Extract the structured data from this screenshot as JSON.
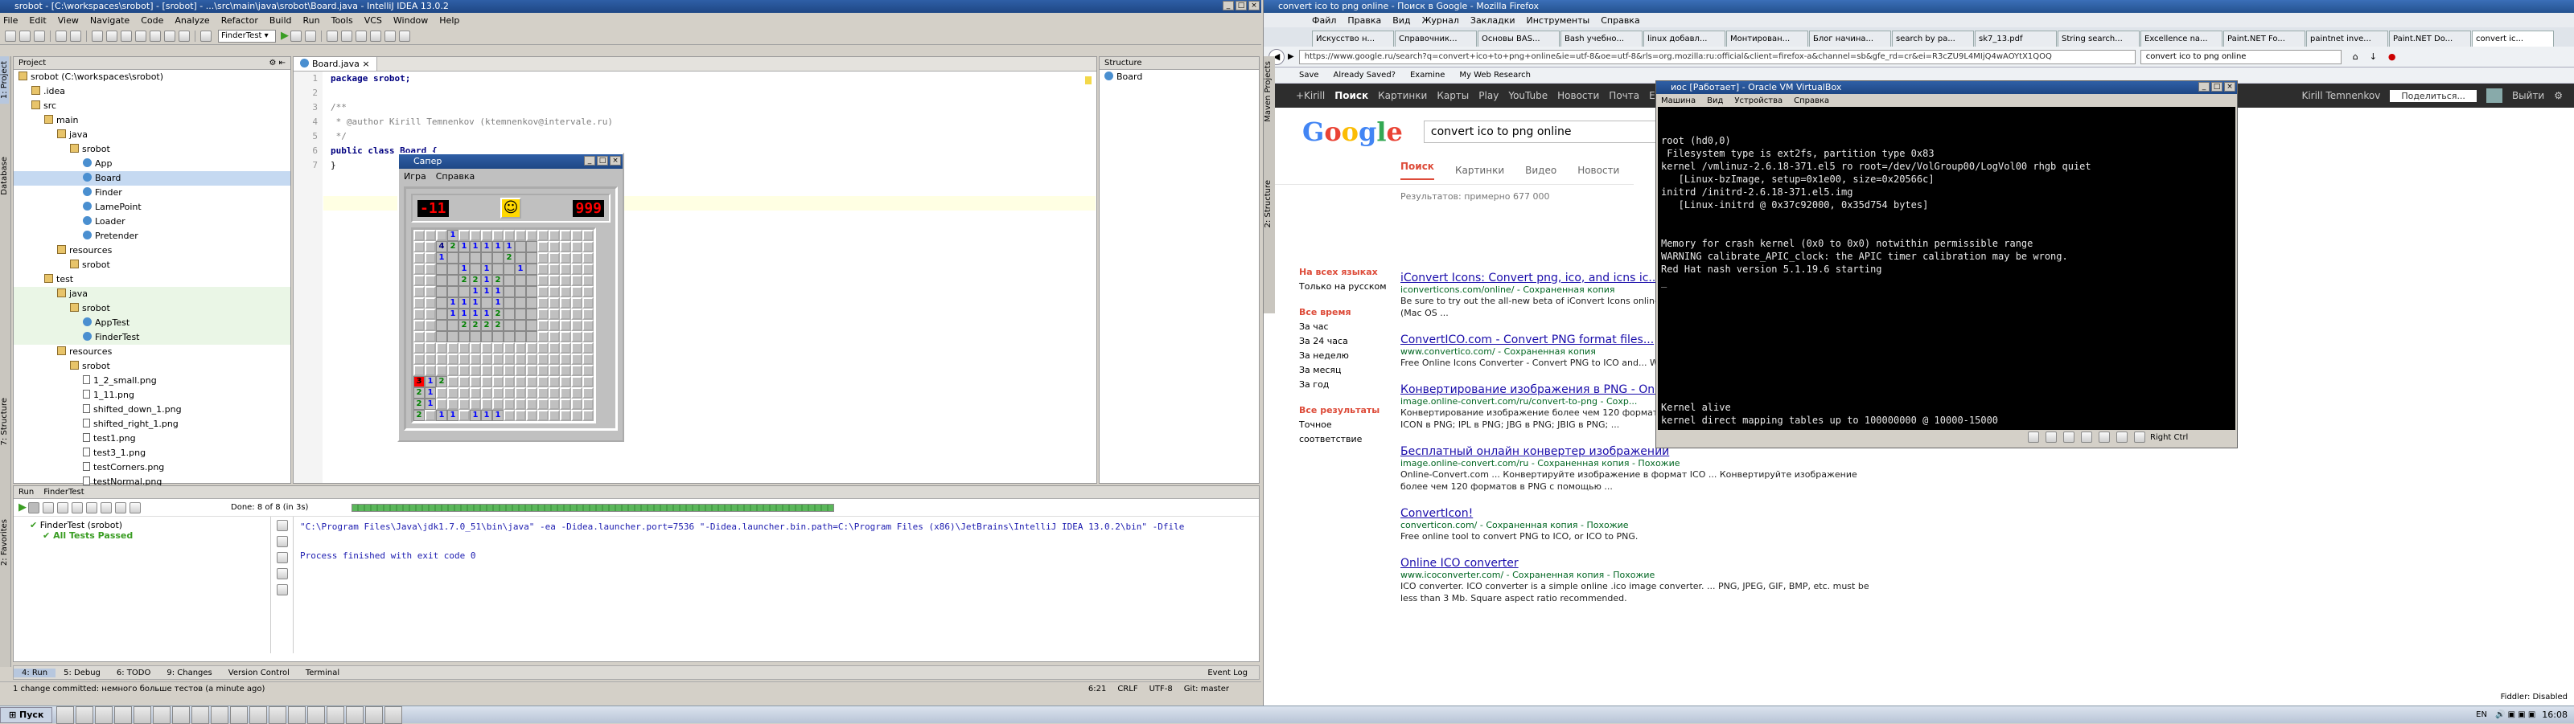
{
  "colors": {
    "ide_bg": "#d4d0c8",
    "selected": "#c5d9f1",
    "test_green": "#5bb75b",
    "google_red": "#dd4b39",
    "vm_console_bg": "#000000",
    "vm_text": "#e8e8e8",
    "link": "#1a0dab",
    "url_green": "#006621"
  },
  "ide": {
    "title": "srobot - [C:\\workspaces\\srobot] - [srobot] - ...\\src\\main\\java\\srobot\\Board.java - IntelliJ IDEA 13.0.2",
    "menu": [
      "File",
      "Edit",
      "View",
      "Navigate",
      "Code",
      "Analyze",
      "Refactor",
      "Build",
      "Run",
      "Tools",
      "VCS",
      "Window",
      "Help"
    ],
    "run_config": "FinderTest",
    "project_header": "Project",
    "left_tabs": [
      "1: Project",
      "Database",
      "7: Structure",
      "2: Favorites"
    ],
    "tree": [
      {
        "label": "srobot (C:\\workspaces\\srobot)",
        "indent": 0,
        "kind": "folder"
      },
      {
        "label": ".idea",
        "indent": 1,
        "kind": "folder"
      },
      {
        "label": "src",
        "indent": 1,
        "kind": "folder"
      },
      {
        "label": "main",
        "indent": 2,
        "kind": "folder"
      },
      {
        "label": "java",
        "indent": 3,
        "kind": "folder"
      },
      {
        "label": "srobot",
        "indent": 4,
        "kind": "folder"
      },
      {
        "label": "App",
        "indent": 5,
        "kind": "class"
      },
      {
        "label": "Board",
        "indent": 5,
        "kind": "class",
        "selected": true
      },
      {
        "label": "Finder",
        "indent": 5,
        "kind": "class"
      },
      {
        "label": "LamePoint",
        "indent": 5,
        "kind": "class"
      },
      {
        "label": "Loader",
        "indent": 5,
        "kind": "class"
      },
      {
        "label": "Pretender",
        "indent": 5,
        "kind": "class"
      },
      {
        "label": "resources",
        "indent": 3,
        "kind": "folder"
      },
      {
        "label": "srobot",
        "indent": 4,
        "kind": "folder"
      },
      {
        "label": "test",
        "indent": 2,
        "kind": "folder"
      },
      {
        "label": "java",
        "indent": 3,
        "kind": "folder",
        "green": true
      },
      {
        "label": "srobot",
        "indent": 4,
        "kind": "folder",
        "green": true
      },
      {
        "label": "AppTest",
        "indent": 5,
        "kind": "class",
        "green": true
      },
      {
        "label": "FinderTest",
        "indent": 5,
        "kind": "class",
        "green": true
      },
      {
        "label": "resources",
        "indent": 3,
        "kind": "folder"
      },
      {
        "label": "srobot",
        "indent": 4,
        "kind": "folder"
      },
      {
        "label": "1_2_small.png",
        "indent": 5,
        "kind": "file"
      },
      {
        "label": "1_11.png",
        "indent": 5,
        "kind": "file"
      },
      {
        "label": "shifted_down_1.png",
        "indent": 5,
        "kind": "file"
      },
      {
        "label": "shifted_right_1.png",
        "indent": 5,
        "kind": "file"
      },
      {
        "label": "test1.png",
        "indent": 5,
        "kind": "file"
      },
      {
        "label": "test3_1.png",
        "indent": 5,
        "kind": "file"
      },
      {
        "label": "testCorners.png",
        "indent": 5,
        "kind": "file"
      },
      {
        "label": "testNormal.png",
        "indent": 5,
        "kind": "file"
      }
    ],
    "editor_tab": "Board.java",
    "code_lines": [
      "package srobot;",
      "",
      "/**",
      " * @author Kirill Temnenkov (ktemnenkov@intervale.ru)",
      " */",
      "public class Board {",
      "}"
    ],
    "line_numbers": [
      "1",
      "2",
      "3",
      "4",
      "5",
      "6",
      "7"
    ],
    "structure_header": "Structure",
    "structure_item": "Board",
    "run_header": "Run",
    "run_tab": "FinderTest",
    "run_status": "Done: 8 of 8 (in 3s)",
    "test_root": "FinderTest (srobot)",
    "test_passed": "All Tests Passed",
    "console": [
      "\"C:\\Program Files\\Java\\jdk1.7.0_51\\bin\\java\" -ea -Didea.launcher.port=7536 \"-Didea.launcher.bin.path=C:\\Program Files (x86)\\JetBrains\\IntelliJ IDEA 13.0.2\\bin\" -Dfile",
      "",
      "Process finished with exit code 0"
    ],
    "bottom_tabs": [
      "4: Run",
      "5: Debug",
      "6: TODO",
      "9: Changes",
      "Version Control",
      "Terminal"
    ],
    "event_log": "Event Log",
    "status_msg": "1 change committed: немного больше тестов (a minute ago)",
    "status_right": [
      "6:21",
      "CRLF",
      "UTF-8",
      "Git: master"
    ],
    "test_progress": 1.0
  },
  "saper": {
    "title": "Сапер",
    "menu": [
      "Игра",
      "Справка"
    ],
    "mines": "-11",
    "timer": "999",
    "face": "☺",
    "grid": [
      "...1......",
      "..4211111.",
      "..1.....2.",
      "....1.1..1",
      "....2212..",
      ".....111..",
      "...111.1..",
      "...11112..",
      "....2222..",
      "..........",
      "..........",
      "..........",
      "..........",
      "312.......",
      "21........",
      "21........",
      "2.11.111.."
    ]
  },
  "firefox": {
    "title": "convert ico to png online - Поиск в Google - Mozilla Firefox",
    "menu": [
      "Файл",
      "Правка",
      "Вид",
      "Журнал",
      "Закладки",
      "Инструменты",
      "Справка"
    ],
    "tabs": [
      "Искусство н...",
      "Справочник...",
      "Основы BAS...",
      "Bash учебно...",
      "linux добавл...",
      "Монтирован...",
      "Блог начина...",
      "search by pa...",
      "sk7_13.pdf",
      "String search...",
      "Excellence na...",
      "Paint.NET Fo...",
      "paintnet inve...",
      "Paint.NET Do...",
      "convert ic..."
    ],
    "url": "https://www.google.ru/search?q=convert+ico+to+png+online&ie=utf-8&oe=utf-8&rls=org.mozilla:ru:official&client=firefox-a&channel=sb&gfe_rd=cr&ei=R3cZU9L4MIjQ4wAOYtX1QOQ",
    "search_box": "convert ico to png online",
    "bookmarks": [
      "Save",
      "Already Saved?",
      "Examine",
      "My Web Research"
    ],
    "google_bar": [
      "+Kirill",
      "Поиск",
      "Картинки",
      "Карты",
      "Play",
      "YouTube",
      "Новости",
      "Почта",
      "Ещё"
    ],
    "user": "Kirill Temnenkov",
    "share": "Поделиться...",
    "logout": "Выйти",
    "query": "convert ico to png online",
    "search_tabs": [
      "Поиск",
      "Картинки",
      "Видео",
      "Новости"
    ],
    "result_count": "Результатов: примерно 677 000",
    "left_filters": {
      "lang_head": "На всех языках",
      "lang_ru": "Только на русском",
      "time_head": "Все время",
      "times": [
        "За час",
        "За 24 часа",
        "За неделю",
        "За месяц",
        "За год"
      ],
      "results_head": "Все результаты",
      "exact": "Точное соответствие"
    },
    "results": [
      {
        "title": "iConvert Icons: Convert png, ico, and icns ic...",
        "url": "iconverticons.com/online/ - Сохраненная копия",
        "snippet": "Be sure to try out the all-new beta of iConvert Icons online... \"Recent Conversions\" Convert to icns icons (Mac OS ..."
      },
      {
        "title": "ConvertICO.com - Convert PNG format files...",
        "url": "www.convertico.com/ - Сохраненная копия",
        "snippet": "Free Online Icons Converter - Convert PNG to ICO and... Windows Vista compatible icons."
      },
      {
        "title": "Конвертирование изображения в PNG - On...",
        "url": "image.online-convert.com/ru/convert-to-png - Сохр...",
        "snippet": "Конвертирование изображение более чем 120 форматов в PNG с помощью ... ICB в PNG; ICO в PNG; ICON в PNG; IPL в PNG; JBG в PNG; JBIG в PNG; ..."
      },
      {
        "title": "Бесплатный онлайн конвертер изображений",
        "url": "image.online-convert.com/ru - Сохраненная копия - Похожие",
        "snippet": "Online-Convert.com ... Конвертируйте изображение в формат ICO ... Конвертируйте изображение более чем 120 форматов в PNG с помощью ..."
      },
      {
        "title": "ConvertIcon!",
        "url": "converticon.com/ - Сохраненная копия - Похожие",
        "snippet": "Free online tool to convert PNG to ICO, or ICO to PNG."
      },
      {
        "title": "Online ICO converter",
        "url": "www.icoconverter.com/ - Сохраненная копия - Похожие",
        "snippet": "ICO converter. ICO converter is a simple online .ico image converter. ... PNG, JPEG, GIF, BMP, etc. must be less than 3 Mb. Square aspect ratio recommended."
      }
    ],
    "status": "Fiddler: Disabled",
    "sidebar_tabs": [
      "Maven Projects",
      "2: Structure"
    ]
  },
  "vbox": {
    "title": "иос [Работает] - Oracle VM VirtualBox",
    "menu": [
      "Машина",
      "Вид",
      "Устройства",
      "Справка"
    ],
    "console": [
      "root (hd0,0)",
      " Filesystem type is ext2fs, partition type 0x83",
      "kernel /vmlinuz-2.6.18-371.el5 ro root=/dev/VolGroup00/LogVol00 rhgb quiet",
      "   [Linux-bzImage, setup=0x1e00, size=0x20566c]",
      "initrd /initrd-2.6.18-371.el5.img",
      "   [Linux-initrd @ 0x37c92000, 0x35d754 bytes]",
      "",
      "",
      "Memory for crash kernel (0x0 to 0x0) notwithin permissible range",
      "WARNING calibrate_APIC_clock: the APIC timer calibration may be wrong.",
      "Red Hat nash version 5.1.19.6 starting",
      "_"
    ],
    "console_bottom": [
      "Kernel alive",
      "kernel direct mapping tables up to 100000000 @ 10000-15000"
    ],
    "hostkey": "Right Ctrl"
  },
  "taskbar": {
    "start": "Пуск",
    "lang": "EN",
    "clock": "16:08",
    "tasks": 18
  }
}
